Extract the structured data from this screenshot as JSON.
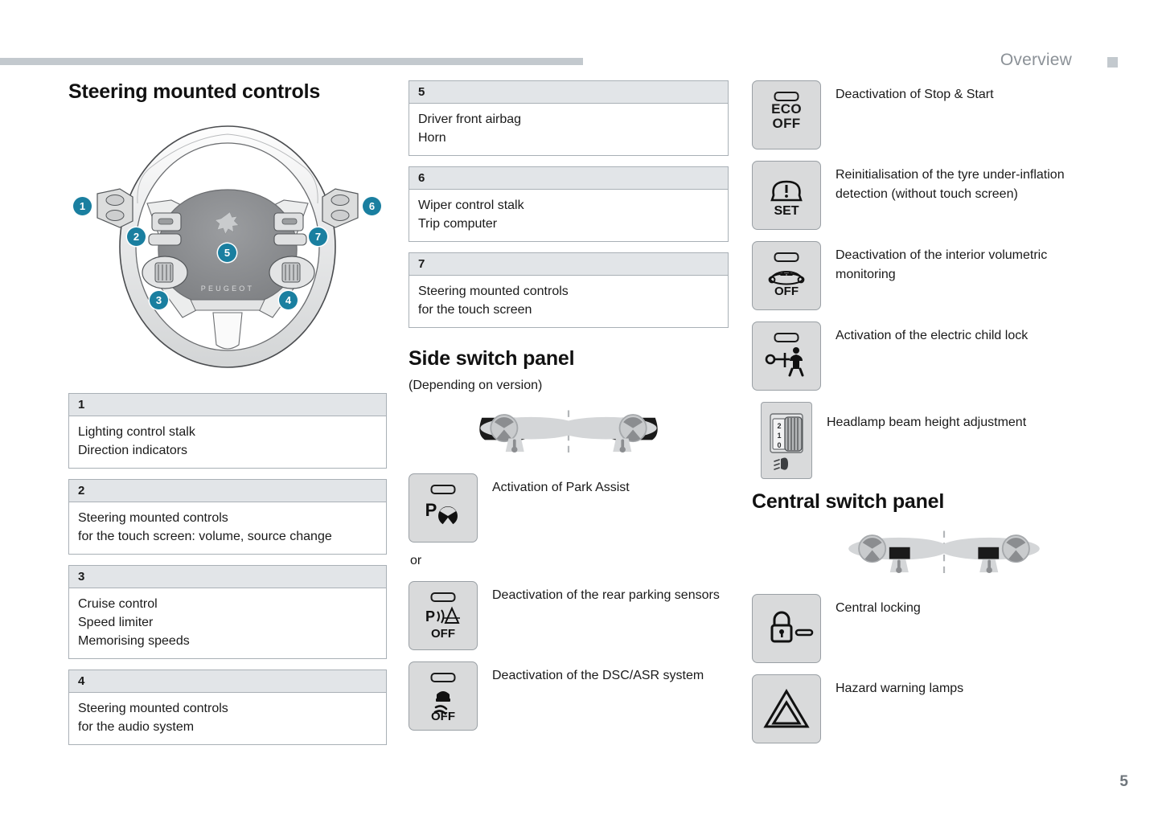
{
  "header": {
    "title": "Overview",
    "tab_marker": "section-tab-square"
  },
  "footer": {
    "page_number": "5"
  },
  "sections": {
    "steering": {
      "heading": "Steering mounted controls",
      "callouts": [
        "1",
        "2",
        "3",
        "4",
        "5",
        "6",
        "7"
      ],
      "wheel_brand": "PEUGEOT"
    },
    "side_panel": {
      "heading": "Side switch panel",
      "note": "(Depending on version)",
      "or": "or"
    },
    "central_panel": {
      "heading": "Central switch panel"
    }
  },
  "legend_left": [
    {
      "num": "1",
      "lines": [
        "Lighting control stalk",
        "Direction indicators"
      ]
    },
    {
      "num": "2",
      "lines": [
        "Steering mounted controls",
        "for the touch screen: volume, source change"
      ]
    },
    {
      "num": "3",
      "lines": [
        "Cruise control",
        "Speed limiter",
        "Memorising speeds"
      ]
    },
    {
      "num": "4",
      "lines": [
        "Steering mounted controls",
        "for the audio system"
      ]
    }
  ],
  "legend_middle": [
    {
      "num": "5",
      "lines": [
        "Driver front airbag",
        "Horn"
      ]
    },
    {
      "num": "6",
      "lines": [
        "Wiper control stalk",
        "Trip computer"
      ]
    },
    {
      "num": "7",
      "lines": [
        "Steering mounted controls",
        "for the touch screen"
      ]
    }
  ],
  "side_buttons": [
    {
      "icon_name": "park-assist-button-icon",
      "glyph": "P",
      "sub": "",
      "label": "Activation of Park Assist"
    },
    {
      "icon_name": "rear-parking-sensors-off-button-icon",
      "glyph": "P",
      "sub": "OFF",
      "label": "Deactivation of the rear parking sensors"
    },
    {
      "icon_name": "dsc-asr-off-button-icon",
      "glyph": "",
      "sub": "OFF",
      "label": "Deactivation of the DSC/ASR system"
    }
  ],
  "right_buttons": [
    {
      "icon_name": "eco-off-button-icon",
      "glyph": "ECO",
      "sub": "OFF",
      "label": "Deactivation of Stop & Start"
    },
    {
      "icon_name": "tyre-pressure-set-button-icon",
      "glyph": "(!)",
      "sub": "SET",
      "label": "Reinitialisation of the tyre under-inflation detection (without touch screen)"
    },
    {
      "icon_name": "volumetric-monitoring-off-button-icon",
      "glyph": "",
      "sub": "OFF",
      "label": "Deactivation of the interior volumetric monitoring"
    },
    {
      "icon_name": "electric-child-lock-button-icon",
      "glyph": "",
      "sub": "",
      "label": "Activation of the electric child lock"
    },
    {
      "icon_name": "headlamp-beam-height-adjustment-icon",
      "glyph": "",
      "sub": "",
      "label": "Headlamp beam height adjustment"
    }
  ],
  "central_buttons": [
    {
      "icon_name": "central-locking-button-icon",
      "label": "Central locking"
    },
    {
      "icon_name": "hazard-warning-lamps-button-icon",
      "label": "Hazard warning lamps"
    }
  ],
  "colors": {
    "callout": "#1a7fa0",
    "header_bar": "#c3c9ce",
    "button_fill": "#d9dadb",
    "table_header": "#e2e5e8"
  }
}
